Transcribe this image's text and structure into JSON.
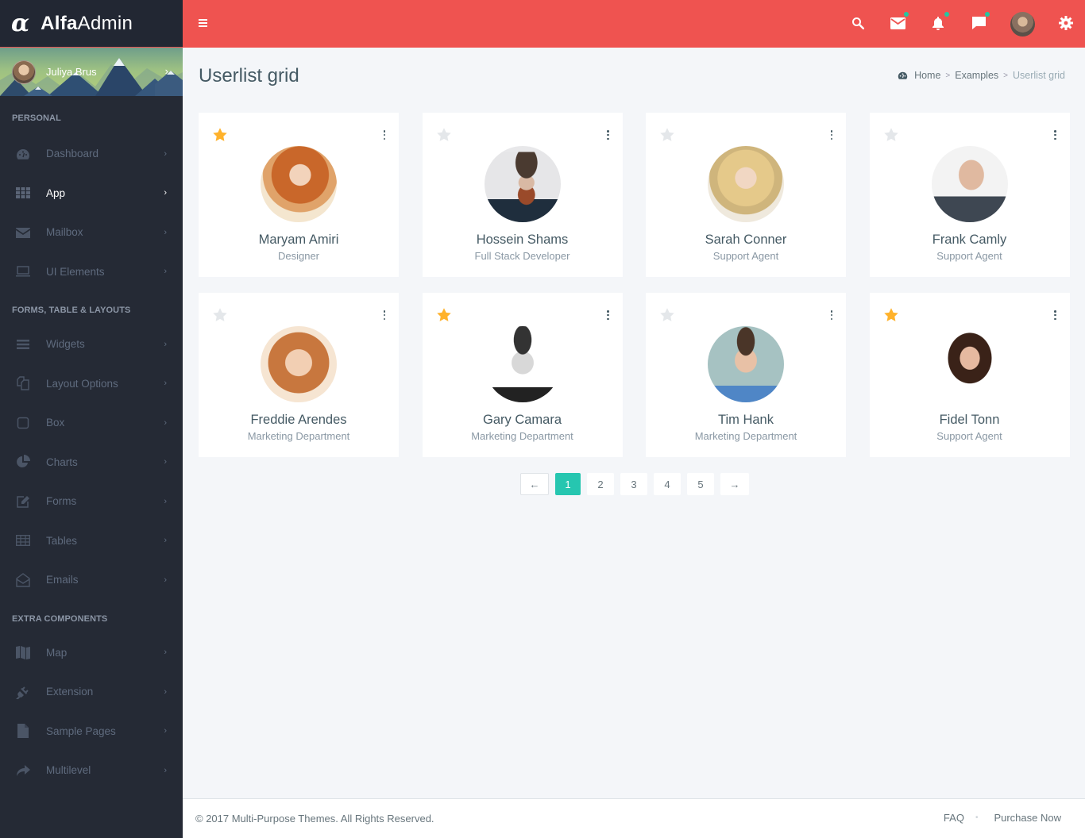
{
  "app": {
    "logo_mark": "α",
    "logo_bold": "Alfa",
    "logo_light": "Admin"
  },
  "user_panel": {
    "name": "Juliya Brus"
  },
  "sidebar": {
    "sections": [
      {
        "heading": "PERSONAL",
        "items": [
          {
            "label": "Dashboard",
            "icon": "dashboard-icon",
            "active": false
          },
          {
            "label": "App",
            "icon": "grid-icon",
            "active": true
          },
          {
            "label": "Mailbox",
            "icon": "envelope-icon",
            "active": false
          },
          {
            "label": "UI Elements",
            "icon": "laptop-icon",
            "active": false
          }
        ]
      },
      {
        "heading": "FORMS, TABLE & LAYOUTS",
        "items": [
          {
            "label": "Widgets",
            "icon": "bars-icon",
            "active": false
          },
          {
            "label": "Layout Options",
            "icon": "copy-icon",
            "active": false
          },
          {
            "label": "Box",
            "icon": "square-icon",
            "active": false
          },
          {
            "label": "Charts",
            "icon": "pie-chart-icon",
            "active": false
          },
          {
            "label": "Forms",
            "icon": "edit-icon",
            "active": false
          },
          {
            "label": "Tables",
            "icon": "table-icon",
            "active": false
          },
          {
            "label": "Emails",
            "icon": "envelope-open-icon",
            "active": false
          }
        ]
      },
      {
        "heading": "EXTRA COMPONENTS",
        "items": [
          {
            "label": "Map",
            "icon": "map-icon",
            "active": false
          },
          {
            "label": "Extension",
            "icon": "plug-icon",
            "active": false
          },
          {
            "label": "Sample Pages",
            "icon": "file-icon",
            "active": false
          },
          {
            "label": "Multilevel",
            "icon": "share-icon",
            "active": false
          }
        ]
      }
    ]
  },
  "topbar": {
    "icons": [
      "search-icon",
      "mail-icon",
      "bell-icon",
      "chat-icon",
      "user-avatar",
      "gear-icon"
    ],
    "notifications": {
      "mail": true,
      "bell": true,
      "chat": true
    }
  },
  "page": {
    "title": "Userlist grid",
    "breadcrumb": [
      "Home",
      "Examples",
      "Userlist grid"
    ]
  },
  "users": [
    {
      "name": "Maryam Amiri",
      "role": "Designer",
      "starred": true
    },
    {
      "name": "Hossein Shams",
      "role": "Full Stack Developer",
      "starred": false
    },
    {
      "name": "Sarah Conner",
      "role": "Support Agent",
      "starred": false
    },
    {
      "name": "Frank Camly",
      "role": "Support Agent",
      "starred": false
    },
    {
      "name": "Freddie Arendes",
      "role": "Marketing Department",
      "starred": false
    },
    {
      "name": "Gary Camara",
      "role": "Marketing Department",
      "starred": true
    },
    {
      "name": "Tim Hank",
      "role": "Marketing Department",
      "starred": false
    },
    {
      "name": "Fidel Tonn",
      "role": "Support Agent",
      "starred": true
    }
  ],
  "pagination": {
    "prev": "←",
    "pages": [
      "1",
      "2",
      "3",
      "4",
      "5"
    ],
    "current": "1",
    "next": "→"
  },
  "footer": {
    "copyright": "© 2017 Multi-Purpose Themes. All Rights Reserved.",
    "links": [
      "FAQ",
      "Purchase Now"
    ]
  },
  "colors": {
    "header": "#ef5350",
    "sidebar": "#252a35",
    "accent": "#26c6b0",
    "star_on": "#ffb22b",
    "star_off": "#e4e7ea",
    "badge": "#26c6a0"
  }
}
